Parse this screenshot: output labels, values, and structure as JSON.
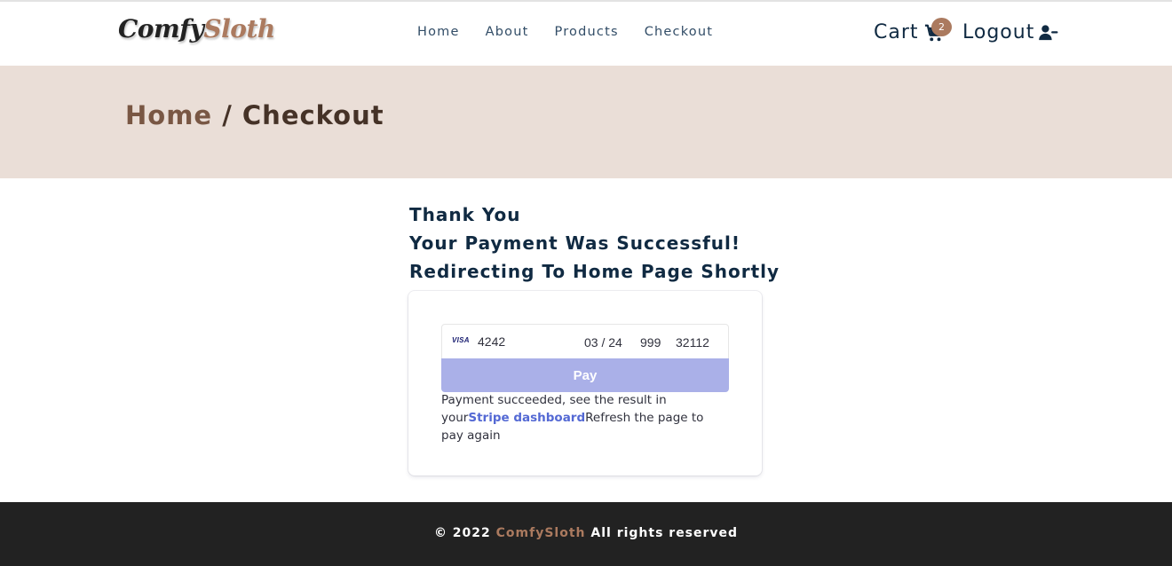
{
  "brand": {
    "part1": "Comfy",
    "part2": "Sloth",
    "accent_color": "#ab7a5f"
  },
  "nav": {
    "links": [
      {
        "label": "Home"
      },
      {
        "label": "About"
      },
      {
        "label": "Products"
      },
      {
        "label": "Checkout"
      }
    ],
    "cart_label": "Cart",
    "cart_icon": "cart-icon",
    "cart_count": "2",
    "logout_label": "Logout",
    "logout_icon": "user-minus-icon"
  },
  "hero": {
    "crumb_home": "Home",
    "separator": " / ",
    "crumb_current": "Checkout",
    "background": "#eaded7"
  },
  "messages": {
    "line1": "Thank You",
    "line2": "Your Payment Was Successful!",
    "line3": "Redirecting To Home Page Shortly"
  },
  "payment": {
    "card_brand": "VISA",
    "card_number": "4242",
    "expiry": "03 / 24",
    "cvc": "999",
    "zip": "32112",
    "pay_label": "Pay",
    "result_text": "Payment succeeded, see the result in your",
    "result_link": "Stripe dashboard",
    "result_tail": "Refresh the page to pay again"
  },
  "footer": {
    "prefix": "© 2022 ",
    "brand": "ComfySloth",
    "suffix": " All rights reserved"
  }
}
